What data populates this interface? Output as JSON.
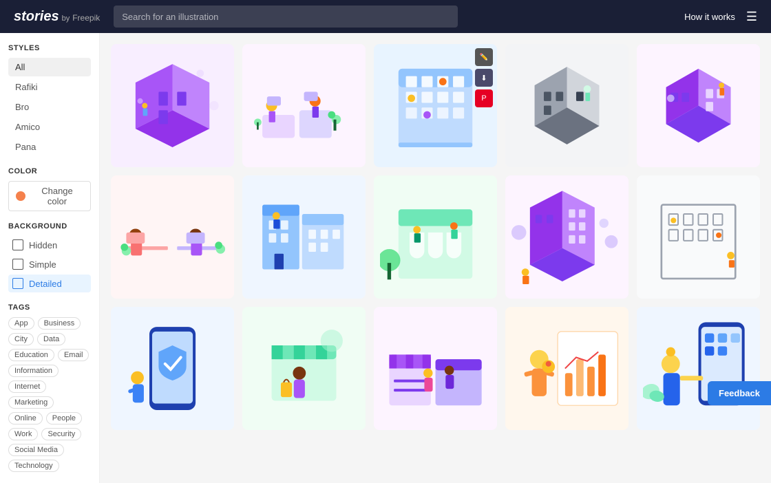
{
  "header": {
    "logo_stories": "stories",
    "logo_by": "by",
    "logo_freepik": "Freepik",
    "search_placeholder": "Search for an illustration",
    "how_it_works": "How it works"
  },
  "sidebar": {
    "styles_label": "STYLES",
    "styles": [
      {
        "id": "all",
        "label": "All",
        "active": true
      },
      {
        "id": "rafiki",
        "label": "Rafiki",
        "active": false
      },
      {
        "id": "bro",
        "label": "Bro",
        "active": false
      },
      {
        "id": "amico",
        "label": "Amico",
        "active": false
      },
      {
        "id": "pana",
        "label": "Pana",
        "active": false
      }
    ],
    "color_label": "COLOR",
    "color_btn": "Change color",
    "background_label": "BACKGROUND",
    "backgrounds": [
      {
        "id": "hidden",
        "label": "Hidden",
        "active": false
      },
      {
        "id": "simple",
        "label": "Simple",
        "active": false
      },
      {
        "id": "detailed",
        "label": "Detailed",
        "active": true
      }
    ],
    "tags_label": "TAGS",
    "tags": [
      "App",
      "Business",
      "City",
      "Data",
      "Education",
      "Email",
      "Information",
      "Internet",
      "Marketing",
      "Online",
      "People",
      "Work",
      "Security",
      "Social Media",
      "Technology"
    ]
  },
  "grid": {
    "rows": [
      [
        {
          "id": "g1",
          "accent": "#c084fc",
          "bg": "#fce7ff",
          "hovered": false
        },
        {
          "id": "g2",
          "accent": "#a855f7",
          "bg": "#fce7ff",
          "hovered": false
        },
        {
          "id": "g3",
          "accent": "#93c5fd",
          "bg": "#e8f4ff",
          "hovered": true
        },
        {
          "id": "g4",
          "accent": "#6b7280",
          "bg": "#f5f5f5",
          "hovered": false
        },
        {
          "id": "g5",
          "accent": "#a855f7",
          "bg": "#fce7ff",
          "hovered": false
        }
      ],
      [
        {
          "id": "g6",
          "accent": "#f87171",
          "bg": "#fff5f5",
          "hovered": false
        },
        {
          "id": "g7",
          "accent": "#60a5fa",
          "bg": "#eff6ff",
          "hovered": false
        },
        {
          "id": "g8",
          "accent": "#6ee7b7",
          "bg": "#f0fdf4",
          "hovered": false
        },
        {
          "id": "g9",
          "accent": "#a855f7",
          "bg": "#fce7ff",
          "hovered": false
        },
        {
          "id": "g10",
          "accent": "#6b7280",
          "bg": "#f5f5f5",
          "hovered": false
        }
      ],
      [
        {
          "id": "g11",
          "accent": "#60a5fa",
          "bg": "#eff6ff",
          "hovered": false
        },
        {
          "id": "g12",
          "accent": "#60a5fa",
          "bg": "#eff6ff",
          "hovered": false
        },
        {
          "id": "g13",
          "accent": "#a855f7",
          "bg": "#fce7ff",
          "hovered": false
        },
        {
          "id": "g14",
          "accent": "#fb923c",
          "bg": "#fff7ed",
          "hovered": false
        },
        {
          "id": "g15",
          "accent": "#60a5fa",
          "bg": "#eff6ff",
          "hovered": false
        }
      ]
    ]
  },
  "feedback": {
    "label": "Feedback"
  }
}
